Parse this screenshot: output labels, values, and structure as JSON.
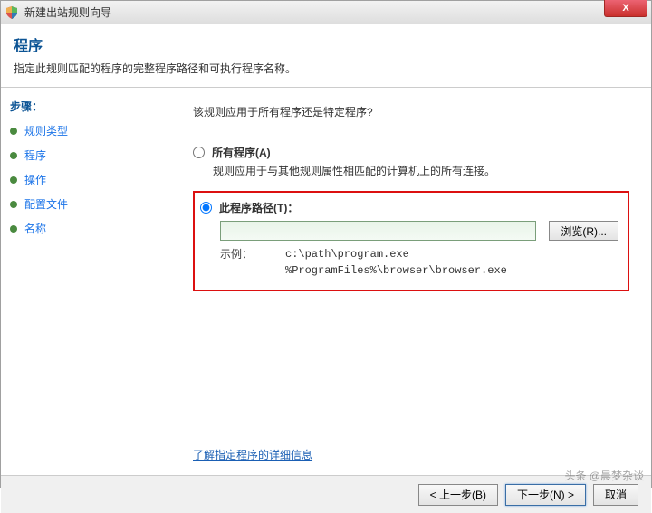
{
  "window": {
    "title": "新建出站规则向导",
    "close_glyph": "X"
  },
  "header": {
    "title": "程序",
    "subtitle": "指定此规则匹配的程序的完整程序路径和可执行程序名称。"
  },
  "sidebar": {
    "steps_title": "步骤：",
    "items": [
      {
        "label": "规则类型"
      },
      {
        "label": "程序"
      },
      {
        "label": "操作"
      },
      {
        "label": "配置文件"
      },
      {
        "label": "名称"
      }
    ]
  },
  "content": {
    "question": "该规则应用于所有程序还是特定程序?",
    "option_all": {
      "label": "所有程序(A)",
      "desc": "规则应用于与其他规则属性相匹配的计算机上的所有连接。"
    },
    "option_path": {
      "label": "此程序路径(T)：",
      "input_value": "",
      "browse": "浏览(R)...",
      "example_label": "示例：",
      "example_text": "c:\\path\\program.exe\n%ProgramFiles%\\browser\\browser.exe"
    },
    "learn_more": "了解指定程序的详细信息"
  },
  "footer": {
    "back": "< 上一步(B)",
    "next": "下一步(N) >",
    "cancel": "取消"
  },
  "watermark": "头条 @晨梦杂谈"
}
